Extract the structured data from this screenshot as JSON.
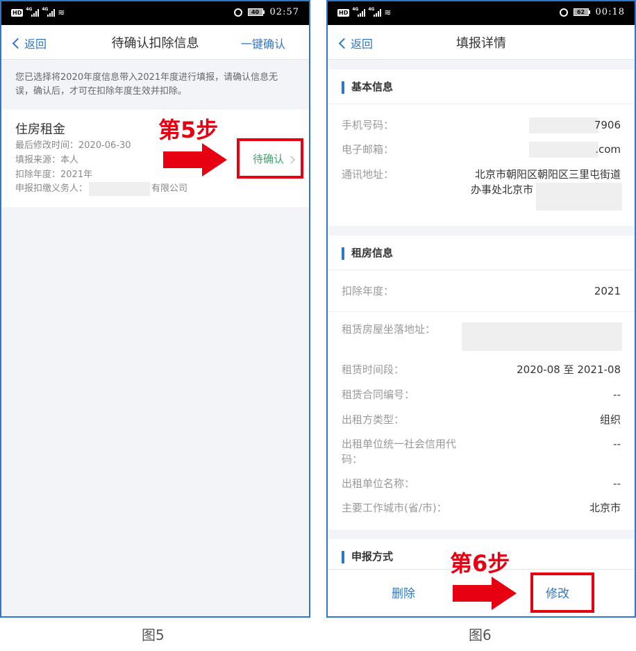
{
  "status_bar_left": {
    "hd": "HD",
    "signal1": "4G",
    "signal2": "4G"
  },
  "panel1": {
    "time": "02:57",
    "battery": "40",
    "back_label": "返回",
    "title": "待确认扣除信息",
    "confirm_all": "一键确认",
    "notice": "您已选择将2020年度信息带入2021年度进行填报，请确认信息无误，确认后，才可在扣除年度生效并扣除。",
    "card": {
      "title": "住房租金",
      "last_modified": "最后修改时间：2020-06-30",
      "source": "填报来源：本人",
      "year": "扣除年度：2021年",
      "withholder_label": "申报扣缴义务人：",
      "withholder_suffix": "有限公司",
      "status": "待确认"
    },
    "step_label": "第5步",
    "caption": "图5"
  },
  "panel2": {
    "time": "00:18",
    "battery": "62",
    "back_label": "返回",
    "title": "填报详情",
    "basic_section": "基本信息",
    "phone_label": "手机号码：",
    "phone_value": "7906",
    "email_label": "电子邮箱：",
    "email_value": ".com",
    "address_label": "通讯地址：",
    "address_line1": "北京市朝阳区朝阳区三里屯街道",
    "address_line2": "办事处北京市",
    "rent_section": "租房信息",
    "year_label": "扣除年度：",
    "year_value": "2021",
    "house_label": "租赁房屋坐落地址：",
    "period_label": "租赁时间段：",
    "period_value": "2020-08 至 2021-08",
    "contract_label": "租赁合同编号：",
    "contract_value": "--",
    "lessor_type_label": "出租方类型：",
    "lessor_type_value": "组织",
    "credit_label_line1": "出租单位统一社会信用代",
    "credit_label_line2": "码：",
    "credit_value": "--",
    "lessor_name_label": "出租单位名称：",
    "lessor_name_value": "--",
    "city_label": "主要工作城市(省/市)：",
    "city_value": "北京市",
    "declare_section": "申报方式",
    "delete_label": "删除",
    "modify_label": "修改",
    "step_label": "第6步",
    "caption": "图6"
  },
  "colors": {
    "accent_blue": "#2f77c8",
    "annotation_red": "#e60012",
    "pending_green": "#3aa46a"
  }
}
